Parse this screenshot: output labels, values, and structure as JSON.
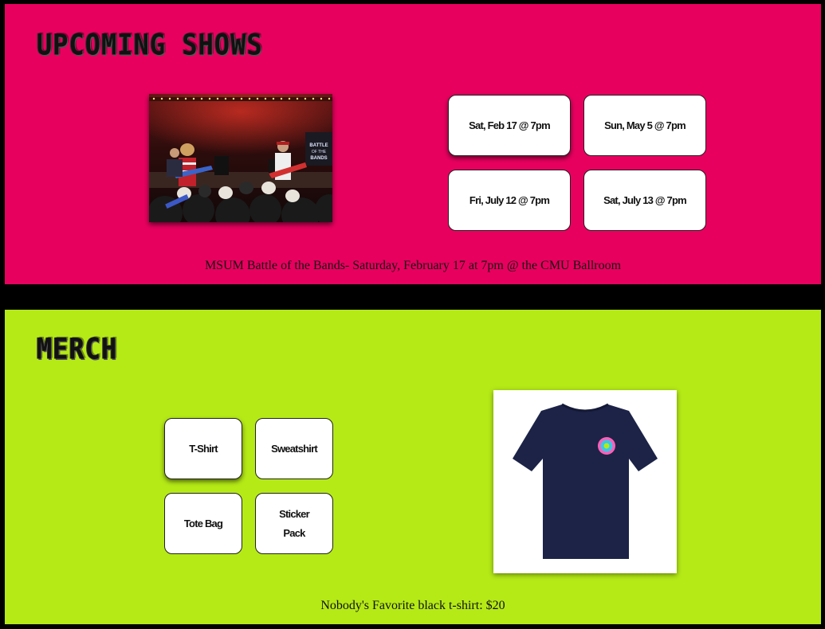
{
  "shows": {
    "title": "Upcoming Shows",
    "dates": [
      "Sat, Feb 17 @ 7pm",
      "Sun, May 5 @ 7pm",
      "Fri, July 12 @ 7pm",
      "Sat, July 13 @ 7pm"
    ],
    "selected_description": "MSUM Battle of the Bands- Saturday, February 17 at 7pm @ the CMU Ballroom",
    "photo": {
      "screen_text": "BATTLE OF THE BANDS"
    }
  },
  "merch": {
    "title": "Merch",
    "items": [
      "T-Shirt",
      "Sweatshirt",
      "Tote Bag",
      "Sticker Pack"
    ],
    "selected_description": "Nobody's Favorite black t-shirt: $20"
  },
  "colors": {
    "shows_bg": "#e8005f",
    "merch_bg": "#b5ea16",
    "page_bg": "#000000",
    "shirt": "#1c2347"
  }
}
